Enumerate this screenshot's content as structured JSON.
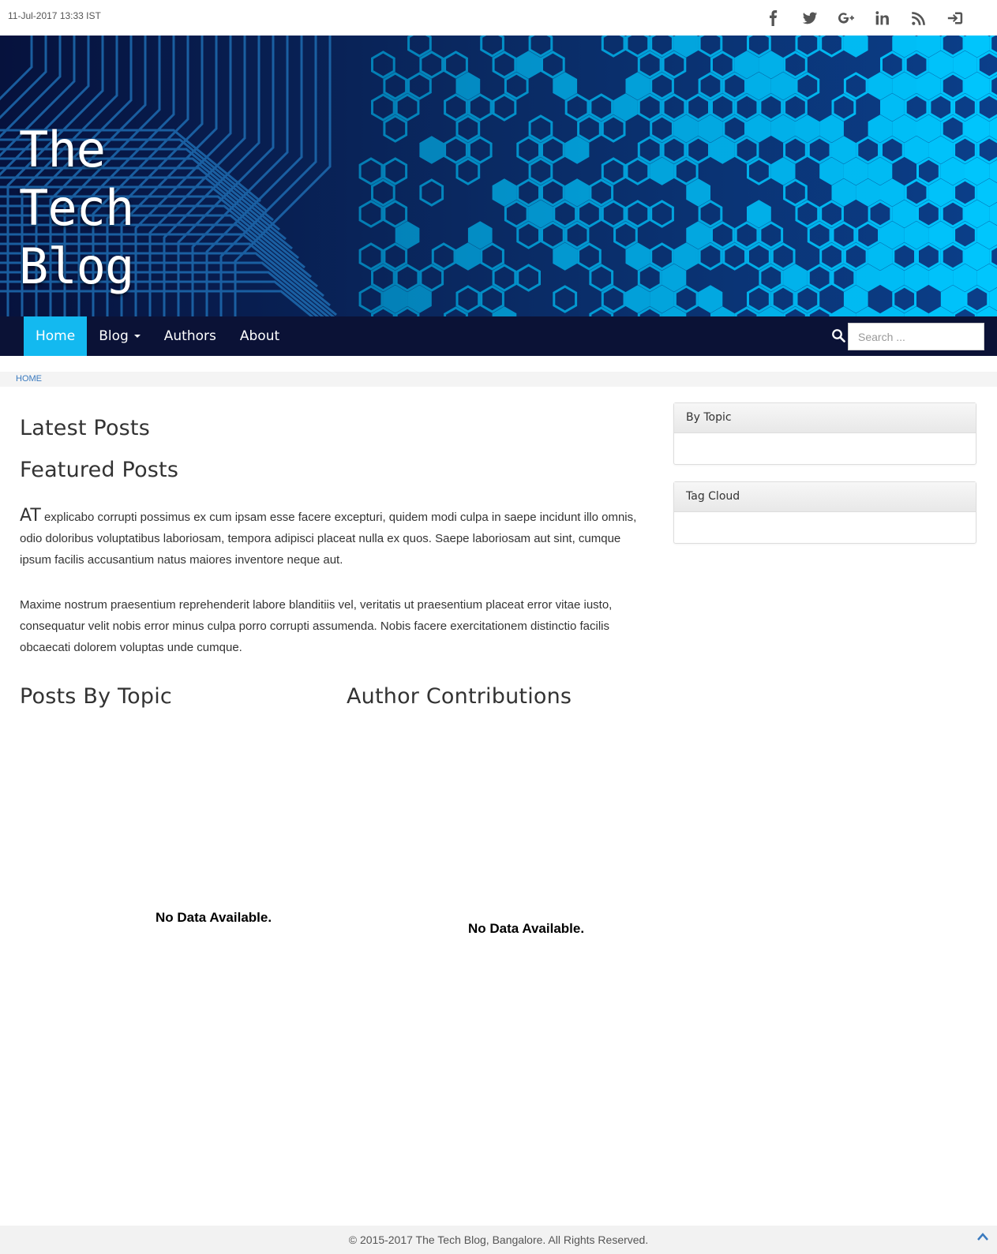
{
  "topbar": {
    "date": "11-Jul-2017 13:33 IST",
    "social_icons": [
      "facebook-icon",
      "twitter-icon",
      "google-plus-icon",
      "linkedin-icon",
      "rss-icon",
      "sign-in-icon"
    ]
  },
  "banner": {
    "title": "The\nTech\nBlog"
  },
  "nav": {
    "items": [
      {
        "label": "Home",
        "active": true
      },
      {
        "label": "Blog",
        "dropdown": true
      },
      {
        "label": "Authors"
      },
      {
        "label": "About"
      }
    ],
    "search_placeholder": "Search ..."
  },
  "breadcrumb": {
    "home": "HOME"
  },
  "main": {
    "latest_posts": "Latest Posts",
    "featured_posts": "Featured Posts",
    "featured_lead": "AT",
    "featured_para1": " explicabo corrupti possimus ex cum ipsam esse facere excepturi, quidem modi culpa in saepe incidunt illo omnis, odio doloribus voluptatibus laboriosam, tempora adipisci placeat nulla ex quos. Saepe laboriosam aut sint, cumque ipsum facilis accusantium natus maiores inventore neque aut.",
    "featured_para2": "Maxime nostrum praesentium reprehenderit labore blanditiis vel, veritatis ut praesentium placeat error vitae iusto, consequatur velit nobis error minus culpa porro corrupti assumenda. Nobis facere exercitationem distinctio facilis obcaecati dolorem voluptas unde cumque.",
    "posts_by_topic": "Posts By Topic",
    "posts_by_topic_nodata": "No Data Available.",
    "author_contributions": "Author Contributions",
    "author_contributions_nodata": "No Data Available."
  },
  "sidebar": {
    "by_topic": "By Topic",
    "tag_cloud": "Tag Cloud"
  },
  "footer": {
    "copyright": "© 2015-2017 The Tech Blog, Bangalore. All Rights Reserved."
  },
  "colors": {
    "nav_bg": "#0b1236",
    "nav_active": "#13b9f0",
    "banner_accent": "#00c8ff"
  }
}
